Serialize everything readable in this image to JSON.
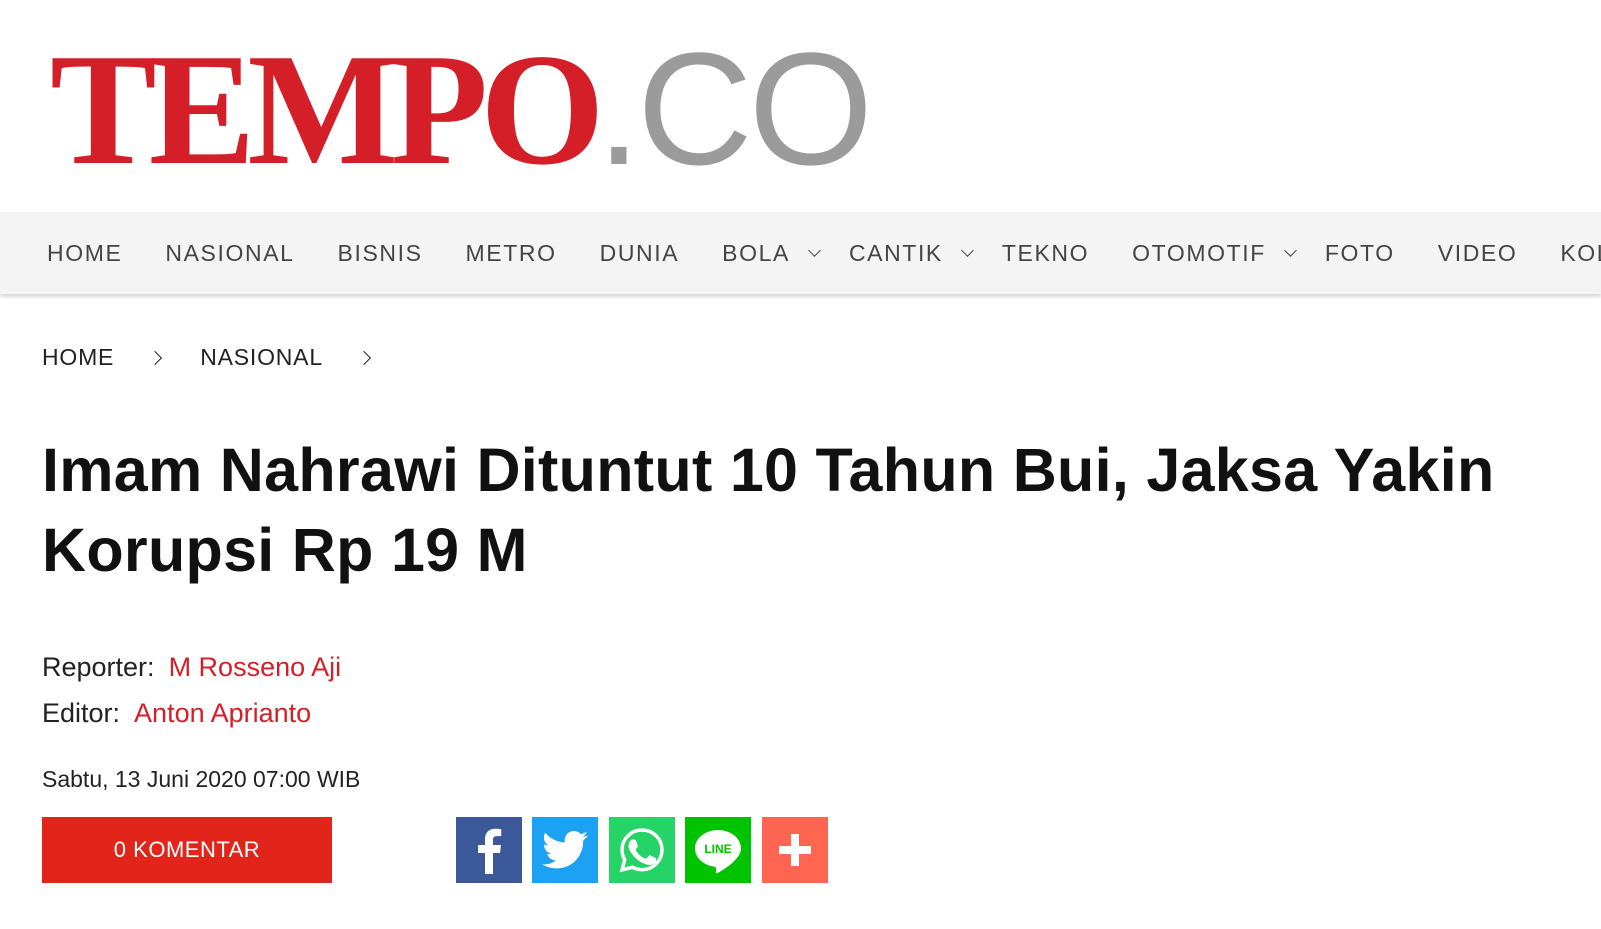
{
  "logo": {
    "part1": "TEMPO",
    "part2": ".CO"
  },
  "nav": {
    "items": [
      {
        "label": "HOME"
      },
      {
        "label": "NASIONAL"
      },
      {
        "label": "BISNIS"
      },
      {
        "label": "METRO"
      },
      {
        "label": "DUNIA"
      },
      {
        "label": "BOLA"
      },
      {
        "label": "CANTIK"
      },
      {
        "label": "TEKNO"
      },
      {
        "label": "OTOMOTIF"
      },
      {
        "label": "FOTO"
      },
      {
        "label": "VIDEO"
      },
      {
        "label": "KOL"
      }
    ]
  },
  "breadcrumb": {
    "items": [
      {
        "label": "HOME"
      },
      {
        "label": "NASIONAL"
      }
    ]
  },
  "article": {
    "title": "Imam Nahrawi Dituntut 10 Tahun Bui, Jaksa Yakin Korupsi Rp 19 M",
    "reporter_label": "Reporter:",
    "reporter_name": "M Rosseno Aji",
    "editor_label": "Editor:",
    "editor_name": "Anton Aprianto",
    "date": "Sabtu, 13 Juni 2020 07:00 WIB"
  },
  "comments": {
    "count": "0",
    "label": "KOMENTAR"
  },
  "share": {
    "buttons": [
      {
        "icon": "facebook-icon",
        "color": "#3b5998"
      },
      {
        "icon": "twitter-icon",
        "color": "#1da1f2"
      },
      {
        "icon": "whatsapp-icon",
        "color": "#25d366"
      },
      {
        "icon": "line-icon",
        "color": "#00c300"
      },
      {
        "icon": "plus-icon",
        "color": "#ff6550"
      }
    ]
  },
  "colors": {
    "brand_red": "#d51f28",
    "logo_gray": "#9b9b9b",
    "nav_bg": "#f4f4f4",
    "button_red": "#e1251b"
  }
}
